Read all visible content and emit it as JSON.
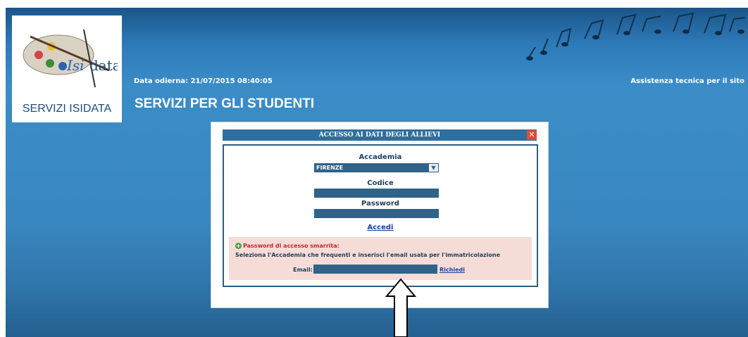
{
  "header": {
    "logo_caption": "SERVIZI ISIDATA",
    "logo_wordmark_i": "Isi",
    "logo_wordmark": "data",
    "date_text": "Data odierna: 21/07/2015 08:40:05",
    "support_link": "Assistenza tecnica per il sito",
    "page_title": "SERVIZI PER GLI STUDENTI"
  },
  "dialog": {
    "title": "ACCESSO AI DATI DEGLI ALLIEVI",
    "close_symbol": "✕",
    "academy_label": "Accademia",
    "academy_selected": "FIRENZE",
    "select_arrow": "▼",
    "code_label": "Codice",
    "code_value": "",
    "password_label": "Password",
    "password_value": "",
    "login_link": "Accedi"
  },
  "recovery": {
    "icon_symbol": "+",
    "title": "Password di accesso smarrita:",
    "description": "Seleziona l'Accademia che frequenti e inserisci l'email usata per l'immatricolazione",
    "email_label": "Email:",
    "email_value": "",
    "request_link": "Richiedi"
  },
  "colors": {
    "header_blue": "#2b79b5",
    "field_blue": "#2f6389",
    "recovery_bg": "#f6dcd6",
    "link_blue": "#1a3fa8",
    "alert_red": "#c0272d",
    "close_red": "#e14a36"
  },
  "icons": [
    "palette-logo-icon",
    "music-notes-decoration",
    "close-icon",
    "dropdown-arrow-icon",
    "plus-circle-icon",
    "pointer-arrow-icon"
  ]
}
